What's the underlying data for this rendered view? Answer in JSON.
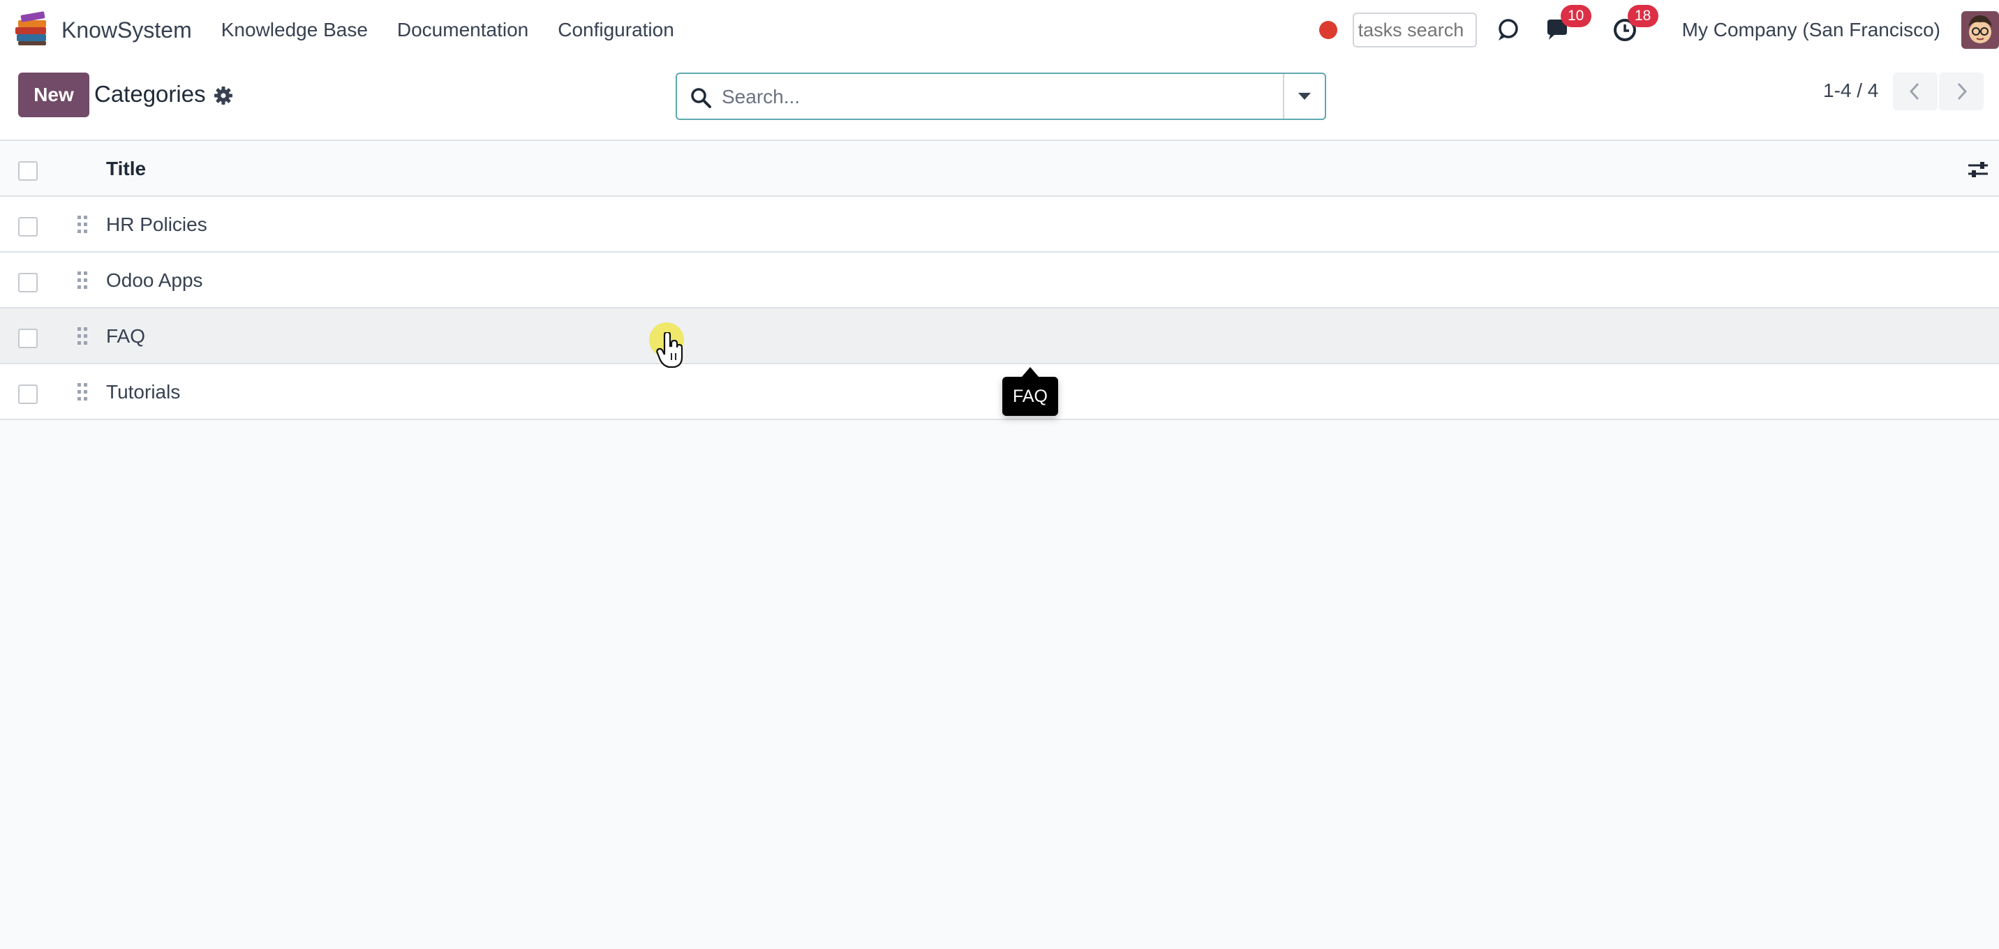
{
  "app": {
    "name": "KnowSystem",
    "menu": [
      "Knowledge Base",
      "Documentation",
      "Configuration"
    ]
  },
  "systray": {
    "tasks_search_placeholder": "tasks search",
    "messages_badge": "10",
    "activities_badge": "18",
    "company": "My Company (San Francisco)"
  },
  "control_panel": {
    "new_label": "New",
    "title": "Categories",
    "search_placeholder": "Search...",
    "pager": "1-4 / 4"
  },
  "list": {
    "columns": [
      "Title"
    ],
    "rows": [
      {
        "title": "HR Policies"
      },
      {
        "title": "Odoo Apps"
      },
      {
        "title": "FAQ"
      },
      {
        "title": "Tutorials"
      }
    ]
  },
  "tooltip": {
    "text": "FAQ"
  },
  "colors": {
    "brand": "#714b67",
    "search_border": "#5fa9b1",
    "badge": "#dc2f45",
    "recording": "#dc3c2f"
  },
  "icons": [
    "books-logo-icon",
    "gear-icon",
    "search-icon",
    "caret-down-icon",
    "chevron-left-icon",
    "chevron-right-icon",
    "drag-handle-icon",
    "sliders-icon",
    "bug-icon",
    "chat-icon",
    "clock-icon"
  ]
}
